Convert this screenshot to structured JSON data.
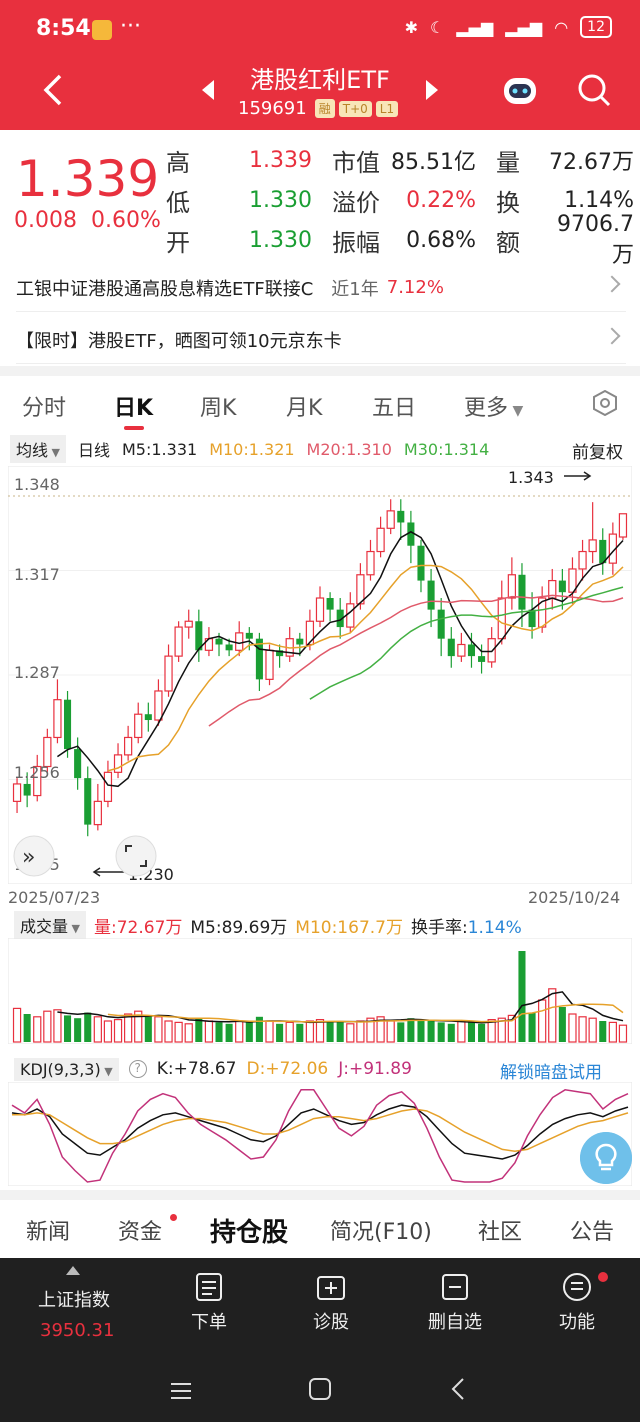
{
  "status_bar": {
    "time": "8:54",
    "battery": "12"
  },
  "header": {
    "title": "港股红利ETF",
    "code": "159691",
    "tags": [
      "融",
      "T+0",
      "L1"
    ]
  },
  "quote": {
    "price": "1.339",
    "change": "0.008",
    "change_pct": "0.60%",
    "rows": [
      {
        "l1": "高",
        "v1": "1.339",
        "l2": "市值",
        "v2": "85.51亿",
        "l3": "量",
        "v3": "72.67万"
      },
      {
        "l1": "低",
        "v1": "1.330",
        "l2": "溢价",
        "v2": "0.22%",
        "l3": "换",
        "v3": "1.14%"
      },
      {
        "l1": "开",
        "v1": "1.330",
        "l2": "振幅",
        "v2": "0.68%",
        "l3": "额",
        "v3": "9706.7万"
      }
    ]
  },
  "links": {
    "fund_name": "工银中证港股通高股息精选ETF联接C",
    "fund_period": "近1年",
    "fund_return": "7.12%",
    "promo": "【限时】港股ETF，晒图可领10元京东卡"
  },
  "chart_tabs": [
    "分时",
    "日K",
    "周K",
    "月K",
    "五日",
    "更多"
  ],
  "ma": {
    "mode": "均线",
    "period": "日线",
    "ma5": "M5:1.331",
    "ma10": "M10:1.321",
    "ma20": "M20:1.310",
    "ma30": "M30:1.314",
    "adjust": "前复权"
  },
  "kline": {
    "y_labels": [
      "1.348",
      "1.317",
      "1.287",
      "1.256",
      "1.225"
    ],
    "max_label": "1.343",
    "min_label": "1.230",
    "date_start": "2025/07/23",
    "date_end": "2025/10/24"
  },
  "volume": {
    "label": "成交量",
    "vol": "量:72.67万",
    "m5": "M5:89.69万",
    "m10": "M10:167.7万",
    "turnover_label": "换手率:",
    "turnover": "1.14%"
  },
  "kdj": {
    "label": "KDJ(9,3,3)",
    "k": "K:+78.67",
    "d": "D:+72.06",
    "j": "J:+91.89",
    "unlock": "解锁暗盘试用"
  },
  "bottom_tabs": [
    "新闻",
    "资金",
    "持仓股",
    "简况(F10)",
    "社区",
    "公告"
  ],
  "nav": {
    "index_name": "上证指数",
    "index_value": "3950.31",
    "items": [
      "下单",
      "诊股",
      "删自选",
      "功能"
    ]
  },
  "colors": {
    "up": "#e8303e",
    "down": "#1a9e33",
    "ma10": "#e6a12a",
    "ma20": "#e05a6a",
    "ma30": "#43b043"
  },
  "chart_data": {
    "type": "candlestick",
    "title": "",
    "y_range": [
      1.215,
      1.352
    ],
    "x_range": [
      "2025/07/23",
      "2025/10/24"
    ],
    "candles": [
      [
        1.24,
        1.246,
        1.236,
        1.248
      ],
      [
        1.246,
        1.242,
        1.238,
        1.25
      ],
      [
        1.242,
        1.252,
        1.24,
        1.256
      ],
      [
        1.252,
        1.262,
        1.25,
        1.265
      ],
      [
        1.262,
        1.275,
        1.26,
        1.282
      ],
      [
        1.275,
        1.258,
        1.255,
        1.278
      ],
      [
        1.258,
        1.248,
        1.244,
        1.262
      ],
      [
        1.248,
        1.232,
        1.228,
        1.252
      ],
      [
        1.232,
        1.24,
        1.23,
        1.246
      ],
      [
        1.24,
        1.25,
        1.238,
        1.254
      ],
      [
        1.25,
        1.256,
        1.248,
        1.26
      ],
      [
        1.256,
        1.262,
        1.254,
        1.266
      ],
      [
        1.262,
        1.27,
        1.26,
        1.274
      ],
      [
        1.27,
        1.268,
        1.264,
        1.274
      ],
      [
        1.268,
        1.278,
        1.266,
        1.282
      ],
      [
        1.278,
        1.29,
        1.276,
        1.294
      ],
      [
        1.29,
        1.3,
        1.288,
        1.302
      ],
      [
        1.3,
        1.302,
        1.296,
        1.306
      ],
      [
        1.302,
        1.292,
        1.288,
        1.306
      ],
      [
        1.292,
        1.296,
        1.29,
        1.3
      ],
      [
        1.296,
        1.294,
        1.29,
        1.298
      ],
      [
        1.294,
        1.292,
        1.29,
        1.296
      ],
      [
        1.292,
        1.298,
        1.29,
        1.302
      ],
      [
        1.298,
        1.296,
        1.292,
        1.3
      ],
      [
        1.296,
        1.282,
        1.278,
        1.298
      ],
      [
        1.282,
        1.292,
        1.28,
        1.294
      ],
      [
        1.292,
        1.29,
        1.286,
        1.294
      ],
      [
        1.29,
        1.296,
        1.288,
        1.3
      ],
      [
        1.296,
        1.294,
        1.29,
        1.298
      ],
      [
        1.294,
        1.302,
        1.292,
        1.306
      ],
      [
        1.302,
        1.31,
        1.3,
        1.314
      ],
      [
        1.31,
        1.306,
        1.302,
        1.312
      ],
      [
        1.306,
        1.3,
        1.296,
        1.31
      ],
      [
        1.3,
        1.308,
        1.298,
        1.312
      ],
      [
        1.308,
        1.318,
        1.306,
        1.322
      ],
      [
        1.318,
        1.326,
        1.316,
        1.33
      ],
      [
        1.326,
        1.334,
        1.324,
        1.338
      ],
      [
        1.334,
        1.34,
        1.332,
        1.344
      ],
      [
        1.34,
        1.336,
        1.33,
        1.344
      ],
      [
        1.336,
        1.328,
        1.322,
        1.34
      ],
      [
        1.328,
        1.316,
        1.312,
        1.33
      ],
      [
        1.316,
        1.306,
        1.3,
        1.32
      ],
      [
        1.306,
        1.296,
        1.29,
        1.31
      ],
      [
        1.296,
        1.29,
        1.286,
        1.3
      ],
      [
        1.29,
        1.294,
        1.288,
        1.298
      ],
      [
        1.294,
        1.29,
        1.286,
        1.298
      ],
      [
        1.29,
        1.288,
        1.284,
        1.294
      ],
      [
        1.288,
        1.296,
        1.286,
        1.3
      ],
      [
        1.296,
        1.31,
        1.294,
        1.316
      ],
      [
        1.31,
        1.318,
        1.306,
        1.324
      ],
      [
        1.318,
        1.306,
        1.3,
        1.322
      ],
      [
        1.306,
        1.3,
        1.296,
        1.312
      ],
      [
        1.3,
        1.31,
        1.298,
        1.314
      ],
      [
        1.31,
        1.316,
        1.306,
        1.32
      ],
      [
        1.316,
        1.312,
        1.306,
        1.32
      ],
      [
        1.312,
        1.32,
        1.308,
        1.324
      ],
      [
        1.32,
        1.326,
        1.316,
        1.33
      ],
      [
        1.326,
        1.33,
        1.322,
        1.343
      ],
      [
        1.33,
        1.322,
        1.318,
        1.334
      ],
      [
        1.322,
        1.332,
        1.318,
        1.336
      ],
      [
        1.331,
        1.339,
        1.33,
        1.339
      ]
    ],
    "volumes": [
      48,
      40,
      36,
      44,
      46,
      38,
      34,
      42,
      36,
      30,
      32,
      40,
      44,
      38,
      36,
      30,
      28,
      26,
      34,
      30,
      28,
      26,
      30,
      28,
      36,
      30,
      26,
      28,
      26,
      30,
      32,
      28,
      30,
      26,
      30,
      34,
      36,
      30,
      28,
      34,
      32,
      30,
      28,
      26,
      30,
      28,
      26,
      32,
      34,
      38,
      130,
      42,
      60,
      76,
      50,
      40,
      36,
      34,
      30,
      28,
      24
    ],
    "kdj_k": [
      72,
      70,
      76,
      68,
      50,
      40,
      30,
      28,
      36,
      44,
      56,
      64,
      70,
      72,
      68,
      64,
      60,
      56,
      50,
      44,
      42,
      48,
      60,
      72,
      76,
      70,
      64,
      60,
      62,
      70,
      76,
      80,
      78,
      68,
      54,
      40,
      30,
      28,
      26,
      24,
      28,
      38,
      50,
      60,
      66,
      70,
      72,
      68,
      74,
      78
    ],
    "kdj_d": [
      70,
      70,
      72,
      70,
      62,
      54,
      46,
      40,
      40,
      42,
      48,
      54,
      60,
      64,
      66,
      66,
      64,
      62,
      58,
      54,
      50,
      50,
      54,
      60,
      66,
      68,
      68,
      66,
      64,
      66,
      70,
      74,
      76,
      74,
      68,
      60,
      52,
      46,
      40,
      34,
      32,
      34,
      40,
      46,
      52,
      58,
      62,
      64,
      68,
      72
    ],
    "kdj_j": [
      80,
      72,
      86,
      60,
      26,
      12,
      0,
      2,
      30,
      50,
      74,
      86,
      92,
      88,
      72,
      60,
      52,
      44,
      34,
      24,
      26,
      44,
      74,
      96,
      96,
      76,
      56,
      48,
      58,
      80,
      90,
      94,
      82,
      56,
      26,
      2,
      0,
      0,
      0,
      4,
      20,
      48,
      70,
      88,
      96,
      94,
      92,
      76,
      86,
      92
    ]
  }
}
